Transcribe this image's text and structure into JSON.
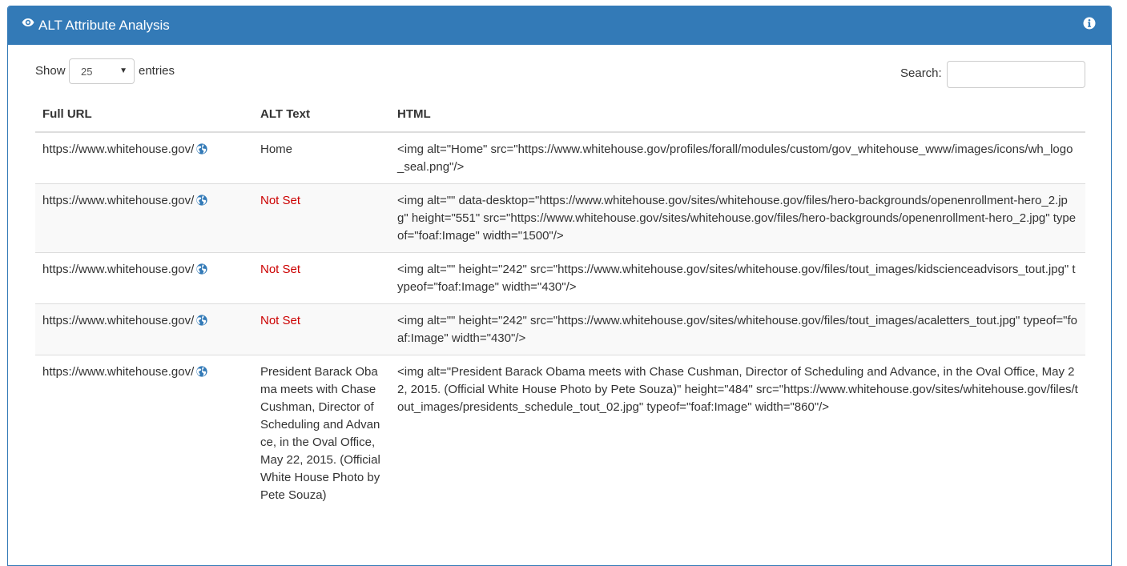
{
  "panel": {
    "title": "ALT Attribute Analysis",
    "icons": {
      "title": "eye-icon",
      "help": "info-icon",
      "url_link": "globe-icon"
    },
    "accent_color": "#337ab7"
  },
  "controls": {
    "show_label": "Show",
    "entries_value": "25",
    "entries_label": "entries",
    "search_label": "Search:",
    "search_value": ""
  },
  "table": {
    "headers": [
      "Full URL",
      "ALT Text",
      "HTML"
    ],
    "rows": [
      {
        "url": "https://www.whitehouse.gov/",
        "alt": "Home",
        "alt_missing": false,
        "html": "<img alt=\"Home\" src=\"https://www.whitehouse.gov/profiles/forall/modules/custom/gov_whitehouse_www/images/icons/wh_logo_seal.png\"/>"
      },
      {
        "url": "https://www.whitehouse.gov/",
        "alt": "Not Set",
        "alt_missing": true,
        "html": "<img alt=\"\" data-desktop=\"https://www.whitehouse.gov/sites/whitehouse.gov/files/hero-backgrounds/openenrollment-hero_2.jpg\" height=\"551\" src=\"https://www.whitehouse.gov/sites/whitehouse.gov/files/hero-backgrounds/openenrollment-hero_2.jpg\" typeof=\"foaf:Image\" width=\"1500\"/>"
      },
      {
        "url": "https://www.whitehouse.gov/",
        "alt": "Not Set",
        "alt_missing": true,
        "html": "<img alt=\"\" height=\"242\" src=\"https://www.whitehouse.gov/sites/whitehouse.gov/files/tout_images/kidscienceadvisors_tout.jpg\" typeof=\"foaf:Image\" width=\"430\"/>"
      },
      {
        "url": "https://www.whitehouse.gov/",
        "alt": "Not Set",
        "alt_missing": true,
        "html": "<img alt=\"\" height=\"242\" src=\"https://www.whitehouse.gov/sites/whitehouse.gov/files/tout_images/acaletters_tout.jpg\" typeof=\"foaf:Image\" width=\"430\"/>"
      },
      {
        "url": "https://www.whitehouse.gov/",
        "alt": "President Barack Obama meets with Chase Cushman, Director of Scheduling and Advance, in the Oval Office, May 22, 2015. (Official White House Photo by Pete Souza)",
        "alt_missing": false,
        "html": "<img alt=\"President Barack Obama meets with Chase Cushman, Director of Scheduling and Advance, in the Oval Office, May 22, 2015. (Official White House Photo by Pete Souza)\" height=\"484\" src=\"https://www.whitehouse.gov/sites/whitehouse.gov/files/tout_images/presidents_schedule_tout_02.jpg\" typeof=\"foaf:Image\" width=\"860\"/>"
      }
    ]
  }
}
